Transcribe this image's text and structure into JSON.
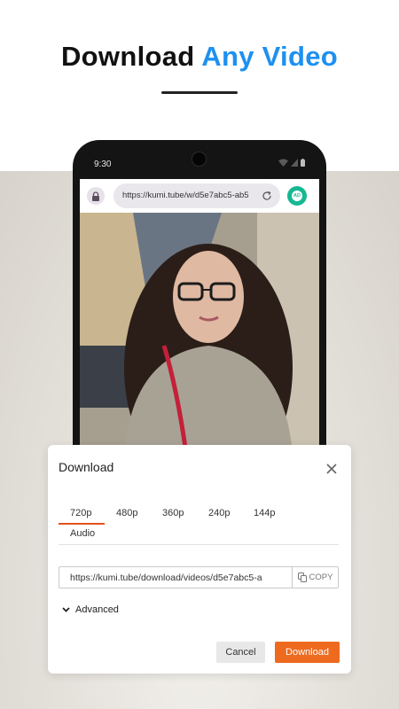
{
  "headline": {
    "part1": "Download ",
    "part2": "Any Video"
  },
  "colors": {
    "accent": "#1e90f0",
    "download_button": "#ee6a1f",
    "ad_badge": "#16b892",
    "tab_underline": "#e4521b"
  },
  "phone": {
    "status_time": "9:30",
    "browser": {
      "url": "https://kumi.tube/w/d5e7abc5-ab5",
      "ad_badge": "AD",
      "icons": [
        "lock-icon",
        "reload-icon",
        "ad-block-icon"
      ]
    }
  },
  "dialog": {
    "title": "Download",
    "tabs": [
      "720p",
      "480p",
      "360p",
      "240p",
      "144p",
      "Audio"
    ],
    "selected_tab": "720p",
    "download_url": "https://kumi.tube/download/videos/d5e7abc5-a",
    "copy_label": "COPY",
    "advanced_label": "Advanced",
    "cancel_label": "Cancel",
    "download_label": "Download"
  }
}
